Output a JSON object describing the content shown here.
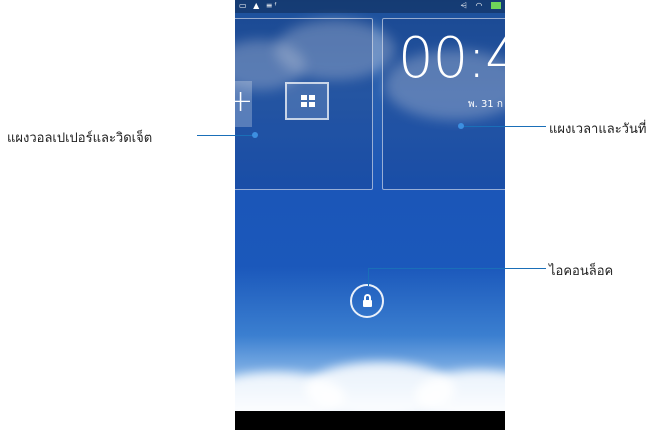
{
  "clock": {
    "time": "00:4",
    "date": "พ. 31 ก"
  },
  "status_bar": {
    "left_icons": "▭ ▲ ≡ᶠ",
    "right_icons": "⩤ ◠"
  },
  "home": {
    "add_symbol": "+"
  },
  "annotations": {
    "wallpaper_widget_panel": "แผงวอลเปเปอร์และวิดเจ็ต",
    "time_date_panel": "แผงเวลาและวันที่",
    "lock_icon": "ไอคอนล็อค"
  },
  "colors": {
    "callout_line": "#1a6fb8",
    "sky": "#1b56b8"
  },
  "icons": [
    "plus-icon",
    "widget-icon",
    "lock-icon",
    "battery-icon",
    "wifi-icon",
    "sound-icon"
  ]
}
